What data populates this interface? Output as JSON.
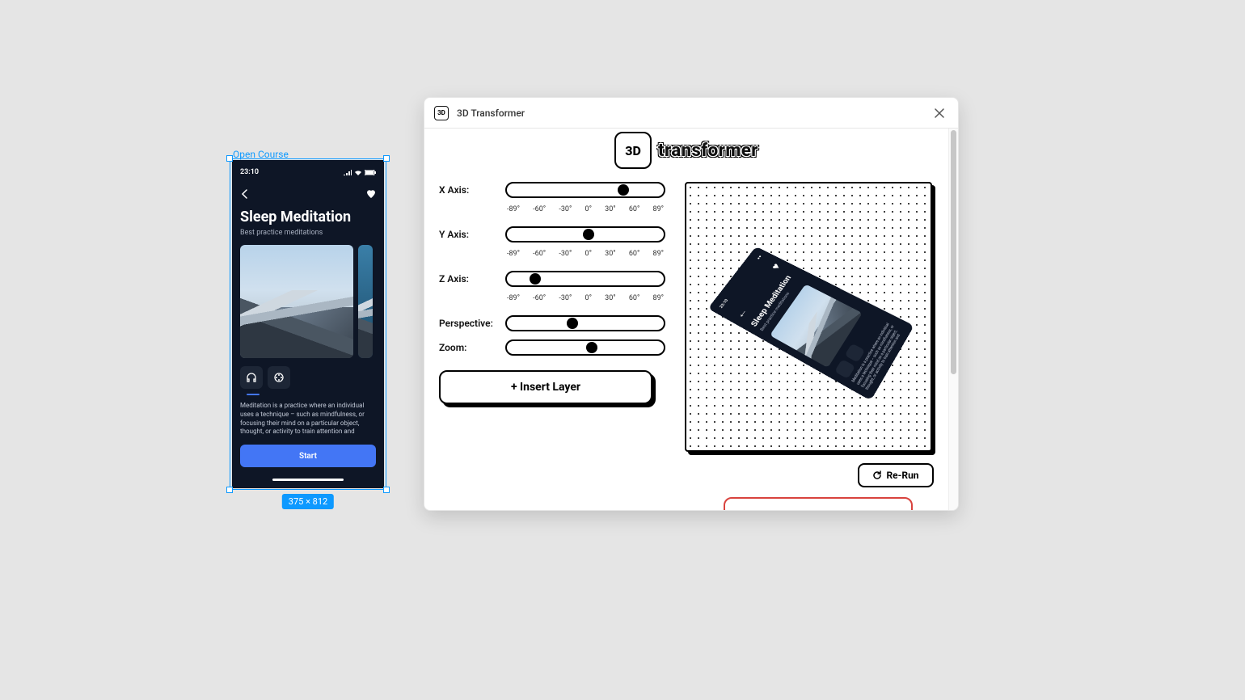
{
  "canvas": {
    "frame_label": "Open Course",
    "dimensions_badge": "375 × 812",
    "phone": {
      "status_time": "23:10",
      "title": "Sleep Meditation",
      "subtitle": "Best practice meditations",
      "description": "Meditation is a practice where an individual uses a technique – such as mindfulness, or focusing their mind on a particular object, thought, or activity to train attention and",
      "start_label": "Start"
    }
  },
  "panel": {
    "title": "3D Transformer",
    "icon_text": "3D",
    "logo_badge": "3D",
    "logo_text": "transformer",
    "controls": {
      "xaxis": {
        "label": "X Axis:",
        "thumb_pct": 74
      },
      "yaxis": {
        "label": "Y Axis:",
        "thumb_pct": 52
      },
      "zaxis": {
        "label": "Z Axis:",
        "thumb_pct": 18
      },
      "perspective": {
        "label": "Perspective:",
        "thumb_pct": 42
      },
      "zoom": {
        "label": "Zoom:",
        "thumb_pct": 54
      },
      "ticks": [
        "-89°",
        "-60°",
        "-30°",
        "0°",
        "30°",
        "60°",
        "89°"
      ]
    },
    "insert_label": "+ Insert Layer",
    "rerun_label": "Re-Run"
  },
  "colors": {
    "figma_blue": "#0d99ff",
    "accent": "#4376f5",
    "phone_bg": "#0e1626"
  }
}
